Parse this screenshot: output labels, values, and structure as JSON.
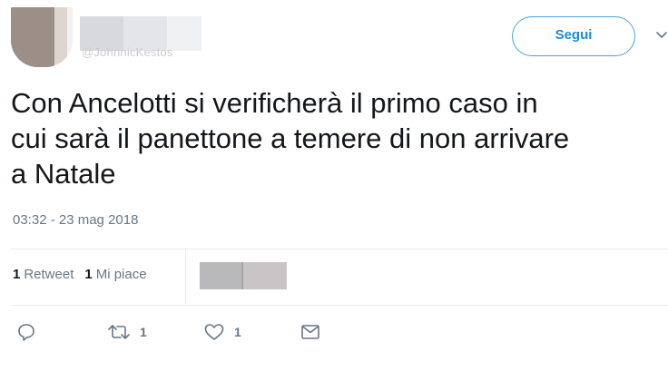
{
  "header": {
    "handle_partial": "@JohnnicKestos",
    "follow_label": "Segui"
  },
  "tweet": {
    "text": "Con Ancelotti si verificherà il primo caso in\ncui sarà il panettone a temere di non arrivare\na Natale",
    "timestamp": "03:32 - 23 mag 2018"
  },
  "stats": {
    "retweets_count": "1",
    "retweets_label": "Retweet",
    "likes_count": "1",
    "likes_label": "Mi piace"
  },
  "actions": {
    "reply_icon": "reply-icon",
    "retweet_icon": "retweet-icon",
    "retweet_count": "1",
    "like_icon": "heart-icon",
    "like_count": "1",
    "dm_icon": "envelope-icon"
  },
  "colors": {
    "accent": "#1d8ad6",
    "secondary_text": "#657786",
    "divider": "#e6ecf0"
  }
}
